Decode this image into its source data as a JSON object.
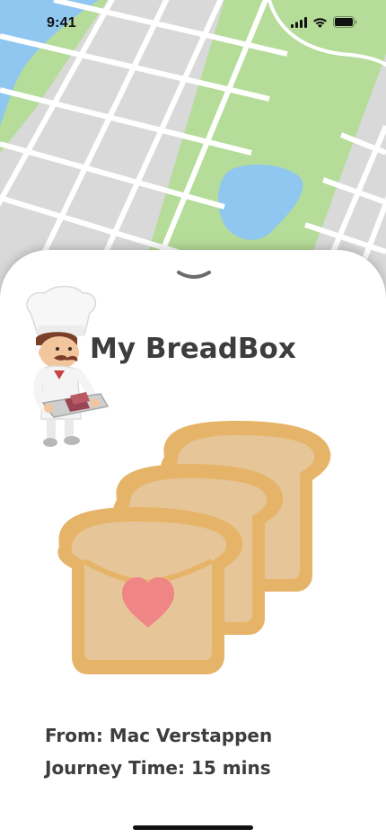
{
  "status_bar": {
    "time": "9:41",
    "icons": [
      "cellular-signal-icon",
      "wifi-icon",
      "battery-icon"
    ]
  },
  "map": {
    "colors": {
      "water": "#8fc7f0",
      "park": "#b5dc98",
      "blocks": "#d9d9d9",
      "roads": "#ffffff"
    }
  },
  "sheet": {
    "handle_icon": "chevron-down-icon",
    "title": "My BreadBox",
    "chef_illustration": "chef-holding-tray-icon",
    "bread_illustration": "stacked-bread-slices-with-heart-icon",
    "from_label": "From:",
    "from_value": "Mac Verstappen",
    "journey_label": "Journey Time:",
    "journey_value": "15 mins"
  },
  "colors": {
    "bread_crust": "#e6b469",
    "bread_crumb": "#e6c598",
    "heart": "#f08586",
    "text": "#3d3d3d"
  }
}
